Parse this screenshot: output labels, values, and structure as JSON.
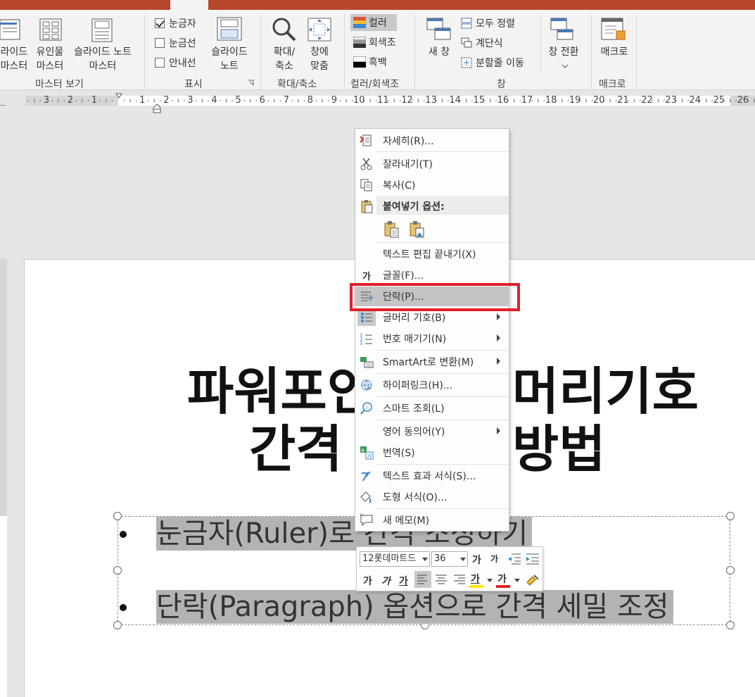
{
  "colors": {
    "title_bar": "#b7472a",
    "ribbon_bg": "#f3f3f3",
    "canvas_bg": "#e6e6e6",
    "highlight_box": "#e0202a",
    "selection_bg": "#b3b3b3"
  },
  "ribbon": {
    "master_view": {
      "items": [
        "라이드\n마스터",
        "유인물\n마스터",
        "슬라이드 노트\n마스터"
      ],
      "label": "마스터 보기"
    },
    "show": {
      "checkboxes": [
        {
          "label": "눈금자",
          "checked": true
        },
        {
          "label": "눈금선",
          "checked": false
        },
        {
          "label": "안내선",
          "checked": false
        }
      ],
      "notes_button": "슬라이드\n노트",
      "label": "표시"
    },
    "zoom": {
      "zoom_button": "확대/\n축소",
      "fit_button": "창에\n맞춤",
      "label": "확대/축소"
    },
    "color": {
      "items": [
        "컬러",
        "회색조",
        "흑백"
      ],
      "label": "컬러/회색조"
    },
    "window": {
      "new_window": "새 창",
      "arrange_all": "모두 정렬",
      "cascade": "계단식",
      "move_split": "분할줄 이동",
      "switch_window": "창 전환",
      "label": "창"
    },
    "macro": {
      "macro_button": "매크로",
      "label": "매크로"
    }
  },
  "ruler": {
    "labels": [
      "3",
      "2",
      "1",
      "1",
      "2",
      "3",
      "4",
      "5",
      "6",
      "7",
      "8",
      "9",
      "10",
      "11",
      "12",
      "13",
      "14",
      "15",
      "16",
      "17",
      "18",
      "19",
      "20",
      "21",
      "22",
      "23",
      "24",
      "25",
      "26"
    ]
  },
  "slide": {
    "title_line1_left": "파워포인",
    "title_line1_right": "머리기호",
    "title_line2_left": "간격",
    "title_line2_right": "방법",
    "bullets": [
      "눈금자(Ruler)로 간격 조정하기",
      "단락(Paragraph) 옵션으로 간격 세밀 조정"
    ]
  },
  "context_menu": {
    "items": [
      {
        "label": "자세히(R)...",
        "icon": "details-icon"
      },
      {
        "label": "잘라내기(T)",
        "icon": "scissors-icon"
      },
      {
        "label": "복사(C)",
        "icon": "copy-icon"
      },
      {
        "label": "붙여넣기 옵션:",
        "icon": "paste-icon"
      },
      {
        "label": "텍스트 편집 끝내기(X)",
        "icon": ""
      },
      {
        "label": "글꼴(F)...",
        "icon": "font-icon"
      },
      {
        "label": "단락(P)...",
        "icon": "paragraph-icon"
      },
      {
        "label": "글머리 기호(B)",
        "icon": "bullets-icon"
      },
      {
        "label": "번호 매기기(N)",
        "icon": "numbering-icon"
      },
      {
        "label": "SmartArt로 변환(M)",
        "icon": "smartart-icon"
      },
      {
        "label": "하이퍼링크(H)...",
        "icon": "hyperlink-icon"
      },
      {
        "label": "스마트 조회(L)",
        "icon": "smart-lookup-icon"
      },
      {
        "label": "영어 동의어(Y)",
        "icon": ""
      },
      {
        "label": "번역(S)",
        "icon": "translate-icon"
      },
      {
        "label": "텍스트 효과 서식(S)...",
        "icon": "text-effects-icon"
      },
      {
        "label": "도형 서식(O)...",
        "icon": "shape-format-icon"
      },
      {
        "label": "새 메모(M)",
        "icon": "comment-icon"
      }
    ]
  },
  "mini_toolbar": {
    "font_name": "12롯데마트드",
    "font_size": "36",
    "bold": "가",
    "italic": "가",
    "underline": "가",
    "highlight": "가",
    "font_color": "가",
    "grow_font": "가",
    "shrink_font": "가"
  }
}
